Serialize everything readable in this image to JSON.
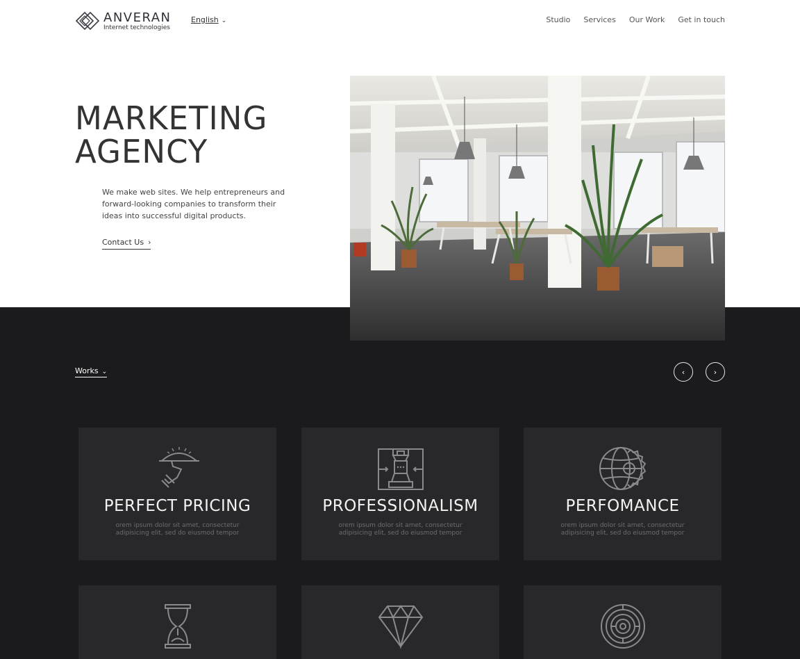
{
  "brand": {
    "name": "ANVERAN",
    "tagline": "Internet technologies"
  },
  "language": {
    "selected": "English"
  },
  "nav": {
    "items": [
      "Studio",
      "Services",
      "Our Work",
      "Get in touch"
    ]
  },
  "hero": {
    "title_line1": "MARKETING",
    "title_line2": "AGENCY",
    "description": "We make web sites. We help entrepreneurs and forward-looking companies to transform their ideas into successful digital products.",
    "cta_label": "Contact Us"
  },
  "works": {
    "label": "Works"
  },
  "features": [
    {
      "title": "PERFECT PRICING",
      "text": "orem ipsum dolor sit amet, consectetur adipisicing elit, sed do eiusmod tempor",
      "icon": "serving-tray-icon"
    },
    {
      "title": "PROFESSIONALISM",
      "text": "orem ipsum dolor sit amet, consectetur adipisicing elit, sed do eiusmod tempor",
      "icon": "chess-rook-icon"
    },
    {
      "title": "PERFOMANCE",
      "text": "orem ipsum dolor sit amet, consectetur adipisicing elit, sed do eiusmod tempor",
      "icon": "globe-gear-icon"
    },
    {
      "icon": "hourglass-icon"
    },
    {
      "icon": "diamond-icon"
    },
    {
      "icon": "target-maze-icon"
    }
  ],
  "colors": {
    "dark_band": "#1b1b1d",
    "card_bg": "#28282a",
    "card_icon": "#8a8a8e"
  }
}
